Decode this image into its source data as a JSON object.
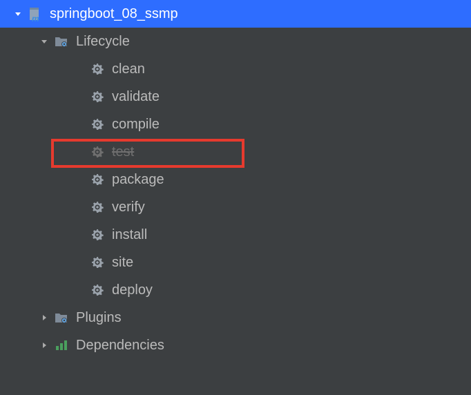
{
  "project": {
    "name": "springboot_08_ssmp"
  },
  "lifecycle": {
    "label": "Lifecycle",
    "items": [
      {
        "name": "clean",
        "disabled": false
      },
      {
        "name": "validate",
        "disabled": false
      },
      {
        "name": "compile",
        "disabled": false
      },
      {
        "name": "test",
        "disabled": true
      },
      {
        "name": "package",
        "disabled": false
      },
      {
        "name": "verify",
        "disabled": false
      },
      {
        "name": "install",
        "disabled": false
      },
      {
        "name": "site",
        "disabled": false
      },
      {
        "name": "deploy",
        "disabled": false
      }
    ]
  },
  "plugins": {
    "label": "Plugins"
  },
  "dependencies": {
    "label": "Dependencies"
  }
}
